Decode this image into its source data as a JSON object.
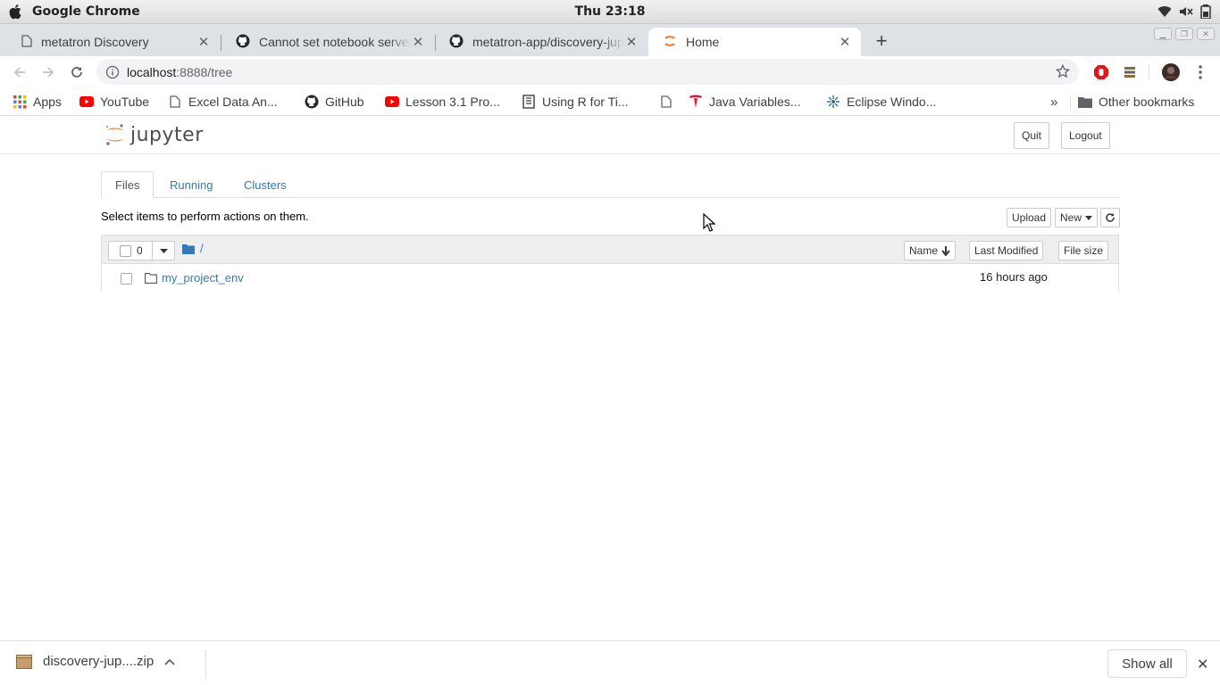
{
  "os": {
    "app_name": "Google Chrome",
    "clock": "Thu 23:18"
  },
  "tabs": [
    {
      "title": "metatron Discovery",
      "icon": "document-icon",
      "active": false
    },
    {
      "title": "Cannot set notebook server",
      "icon": "github-icon",
      "active": false
    },
    {
      "title": "metatron-app/discovery-jupyter",
      "icon": "github-icon",
      "active": false
    },
    {
      "title": "Home",
      "icon": "jupyter-loading-icon",
      "active": true
    }
  ],
  "address_bar": {
    "host": "localhost",
    "path": ":8888/tree"
  },
  "bookmarks": [
    {
      "label": "Apps",
      "icon": "apps-grid-icon"
    },
    {
      "label": "YouTube",
      "icon": "youtube-icon"
    },
    {
      "label": "Excel Data An...",
      "icon": "document-icon"
    },
    {
      "label": "GitHub",
      "icon": "github-icon"
    },
    {
      "label": "Lesson 3.1 Pro...",
      "icon": "youtube-icon"
    },
    {
      "label": "Using R for Ti...",
      "icon": "book-icon"
    },
    {
      "label": "",
      "icon": "document-icon"
    },
    {
      "label": "Java Variables...",
      "icon": "tesla-icon"
    },
    {
      "label": "Eclipse Windo...",
      "icon": "eclipse-icon"
    }
  ],
  "bookmarks_overflow": "»",
  "other_bookmarks": "Other bookmarks",
  "jupyter": {
    "logo_text": "jupyter",
    "quit_label": "Quit",
    "logout_label": "Logout",
    "tabs": [
      "Files",
      "Running",
      "Clusters"
    ],
    "hint": "Select items to perform actions on them.",
    "upload_label": "Upload",
    "new_label": "New",
    "selected_count": "0",
    "breadcrumb": "/",
    "columns": {
      "name": "Name",
      "last_modified": "Last Modified",
      "file_size": "File size"
    },
    "items": [
      {
        "name": "my_project_env",
        "modified": "16 hours ago",
        "type": "folder"
      }
    ]
  },
  "downloads": {
    "file": "discovery-jup....zip",
    "show_all": "Show all"
  }
}
